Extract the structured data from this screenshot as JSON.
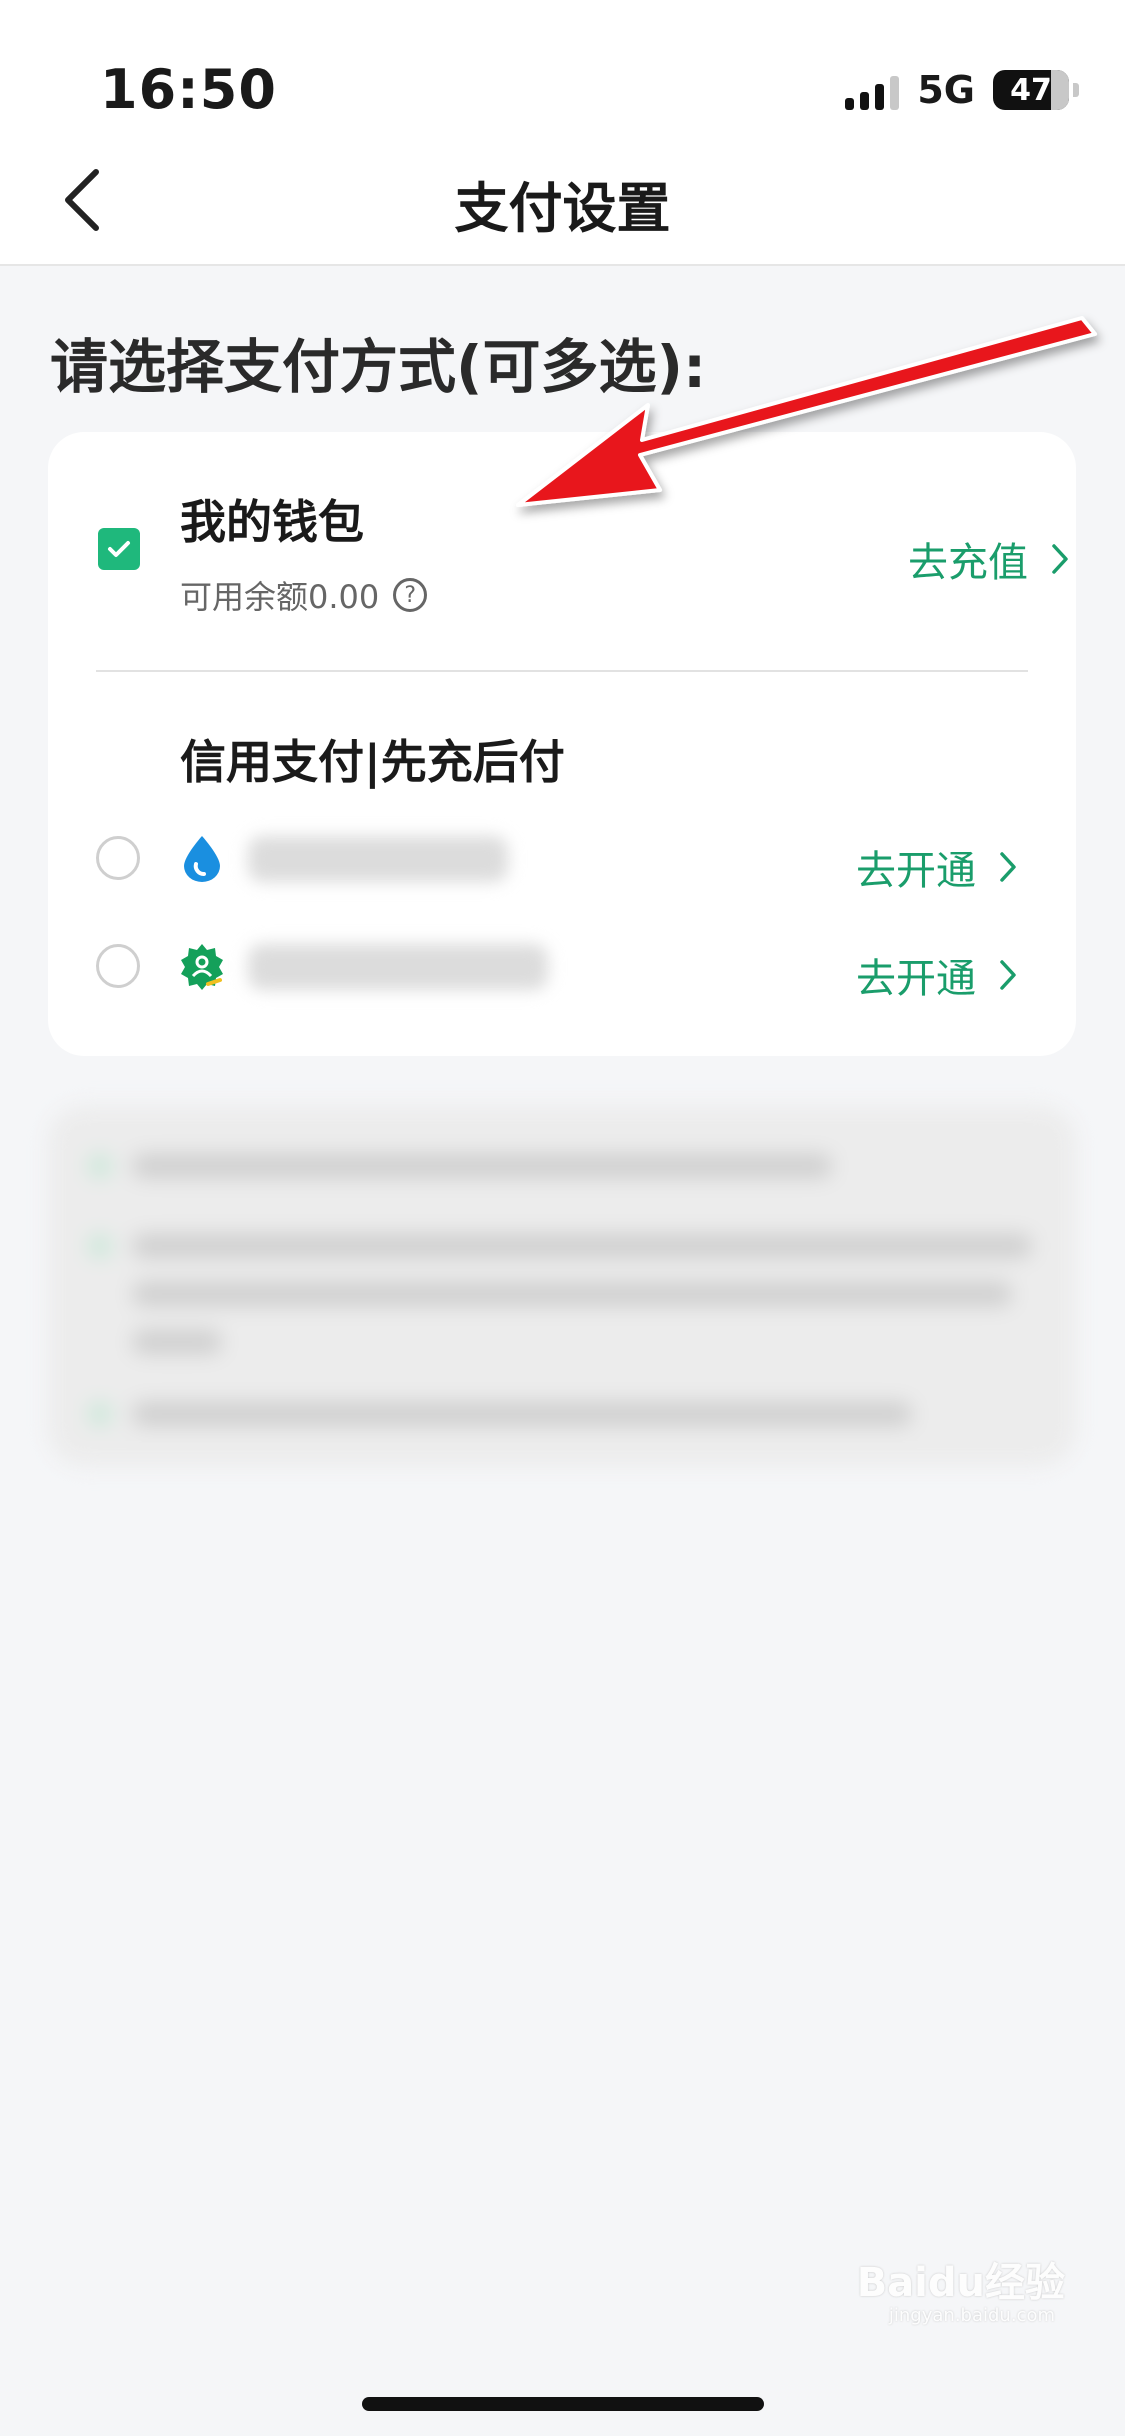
{
  "status_bar": {
    "time": "16:50",
    "network": "5G",
    "battery": "47"
  },
  "header": {
    "title": "支付设置"
  },
  "section_heading": "请选择支付方式(可多选):",
  "wallet": {
    "title": "我的钱包",
    "balance": "可用余额0.00",
    "help_icon": "?",
    "action_label": "去充值",
    "checked": true
  },
  "credit": {
    "title": "信用支付|先充后付",
    "options": [
      {
        "icon": "water-drop-icon",
        "action_label": "去开通",
        "selected": false
      },
      {
        "icon": "badge-user-icon",
        "action_label": "去开通",
        "selected": false
      }
    ]
  },
  "watermark": {
    "brand": "Baidu经验",
    "url": "jingyan.baidu.com"
  },
  "colors": {
    "accent": "#1a9d6b",
    "check": "#1fb87c",
    "arrow": "#e8191c"
  }
}
